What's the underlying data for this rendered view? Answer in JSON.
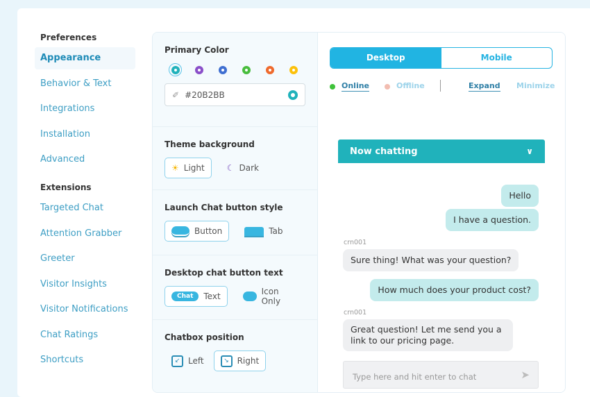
{
  "sidebar": {
    "preferences_title": "Preferences",
    "preferences": [
      "Appearance",
      "Behavior & Text",
      "Integrations",
      "Installation",
      "Advanced"
    ],
    "extensions_title": "Extensions",
    "extensions": [
      "Targeted Chat",
      "Attention Grabber",
      "Greeter",
      "Visitor Insights",
      "Visitor Notifications",
      "Chat Ratings",
      "Shortcuts"
    ]
  },
  "settings": {
    "primary_color": {
      "title": "Primary Color",
      "swatches": [
        "#20b2bb",
        "#8a4fc9",
        "#3f6fd1",
        "#48bd3e",
        "#ef6a2d",
        "#fcc10b"
      ],
      "value": "#20B2BB"
    },
    "theme": {
      "title": "Theme background",
      "light": "Light",
      "dark": "Dark"
    },
    "launch": {
      "title": "Launch Chat button style",
      "button": "Button",
      "tab": "Tab"
    },
    "desktop_text": {
      "title": "Desktop chat button text",
      "chip": "Chat",
      "text": "Text",
      "icon_only": "Icon Only"
    },
    "position": {
      "title": "Chatbox position",
      "left": "Left",
      "right": "Right"
    }
  },
  "preview": {
    "desktop": "Desktop",
    "mobile": "Mobile",
    "online": "Online",
    "offline": "Offline",
    "expand": "Expand",
    "minimize": "Minimize",
    "chat_title": "Now chatting",
    "messages": [
      "Hello",
      "I have a question.",
      "Sure thing! What was your question?",
      "How much does your product cost?",
      "Great question! Let me send you a link to our pricing page."
    ],
    "agent": "crn001",
    "placeholder": "Type here and hit enter to chat"
  },
  "colors": {
    "accent": "#21b4e2",
    "chat_header": "#20b2bb"
  }
}
